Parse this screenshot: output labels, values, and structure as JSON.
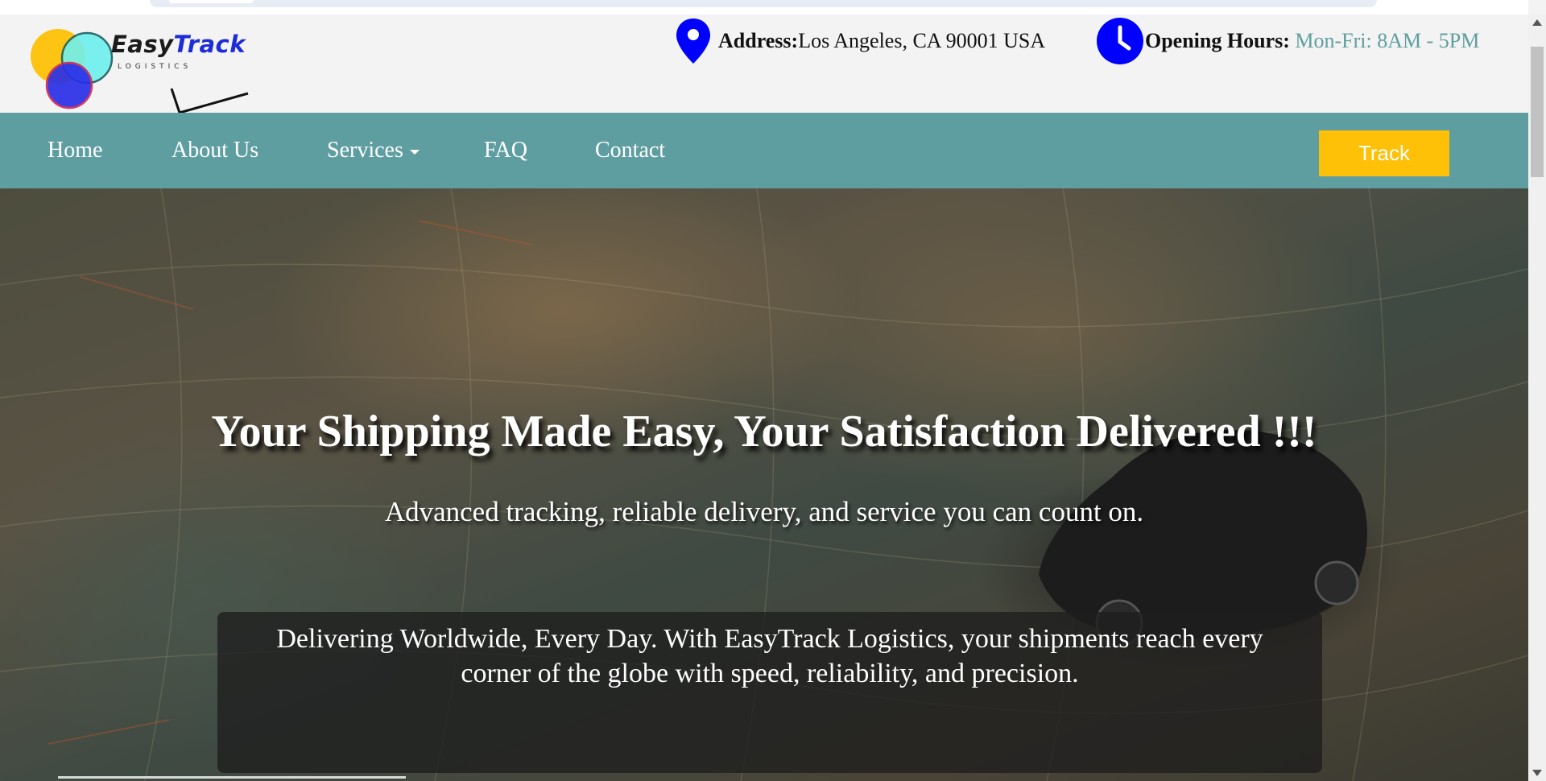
{
  "brand": {
    "name_part1": "Easy",
    "name_part2": "Track",
    "tagline": "LOGISTICS",
    "colors": {
      "yellow": "#fec107",
      "cyan": "#6ef0ee",
      "blue": "#2a2fe8",
      "text_blue": "#1d2bd8"
    }
  },
  "header": {
    "address_label": "Address:",
    "address_value": "Los Angeles, CA 90001 USA",
    "address_icon": "map-pin-icon",
    "hours_label": "Opening Hours:",
    "hours_value": "Mon-Fri: 8AM - 5PM",
    "hours_icon": "clock-icon",
    "icon_color": "#0000ff"
  },
  "nav": {
    "items": [
      {
        "label": "Home"
      },
      {
        "label": "About Us"
      },
      {
        "label": "Services",
        "has_dropdown": true
      },
      {
        "label": "FAQ"
      },
      {
        "label": "Contact"
      }
    ],
    "track_label": "Track",
    "bar_color": "#5f9ea0"
  },
  "hero": {
    "title": "Your Shipping Made Easy, Your Satisfaction Delivered !!!",
    "subtitle": "Advanced tracking, reliable delivery, and service you can count on.",
    "box_text": "Delivering Worldwide, Every Day. With EasyTrack Logistics, your shipments reach every corner of the globe with speed, reliability, and precision."
  }
}
